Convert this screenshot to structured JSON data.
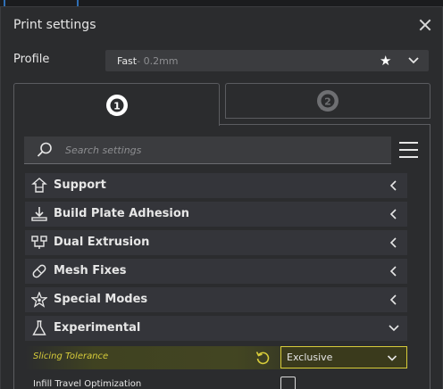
{
  "dialog": {
    "title": "Print settings"
  },
  "profile": {
    "label": "Profile",
    "name": "Fast",
    "detail": " - 0.2mm"
  },
  "tabs": [
    {
      "label": "1",
      "active": true
    },
    {
      "label": "2",
      "active": false
    }
  ],
  "search": {
    "placeholder": "Search settings"
  },
  "categories": [
    {
      "label": "Support",
      "icon": "support-icon",
      "expanded": false
    },
    {
      "label": "Build Plate Adhesion",
      "icon": "build-plate-icon",
      "expanded": false
    },
    {
      "label": "Dual Extrusion",
      "icon": "dual-extrusion-icon",
      "expanded": false
    },
    {
      "label": "Mesh Fixes",
      "icon": "mesh-fixes-icon",
      "expanded": false
    },
    {
      "label": "Special Modes",
      "icon": "special-modes-icon",
      "expanded": false
    },
    {
      "label": "Experimental",
      "icon": "flask-icon",
      "expanded": true
    }
  ],
  "settings": [
    {
      "label": "Slicing Tolerance",
      "value": "Exclusive",
      "highlighted": true
    },
    {
      "label": "Infill Travel Optimization",
      "checked": false
    }
  ],
  "colors": {
    "background": "#2b2c2e",
    "field": "#3b3c3f",
    "highlight": "#d7cc3a",
    "text": "#e6e6e6"
  }
}
